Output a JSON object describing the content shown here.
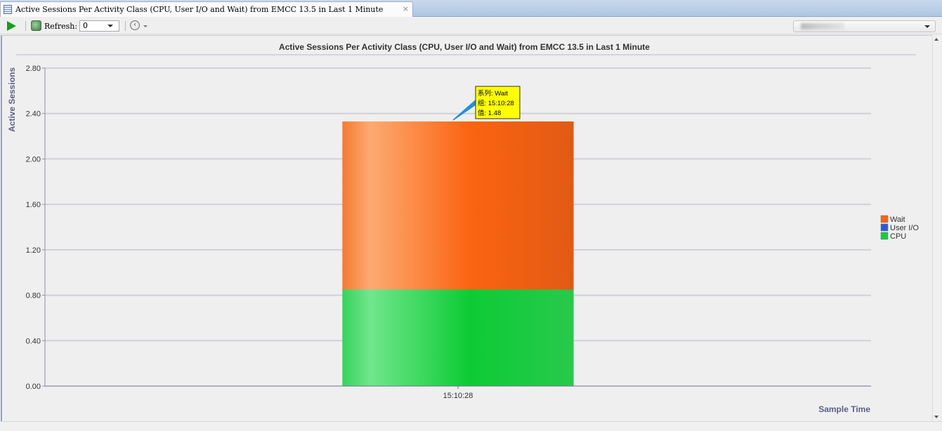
{
  "tab": {
    "title": "Active Sessions Per Activity Class (CPU, User I/O and Wait) from EMCC 13.5 in Last 1 Minute",
    "close_glyph": "×"
  },
  "toolbar": {
    "refresh_label": "Refresh:",
    "refresh_value": "0",
    "back_glyph": "‹"
  },
  "icons": {
    "run": "play-icon",
    "refresh": "refresh-icon",
    "back": "back-arrow-icon"
  },
  "chart_data": {
    "type": "bar",
    "stacked": true,
    "title": "Active Sessions Per Activity Class (CPU, User I/O and Wait) from EMCC 13.5 in Last 1 Minute",
    "xlabel": "Sample Time",
    "ylabel": "Active Sessions",
    "categories": [
      "15:10:28"
    ],
    "ylim": [
      0,
      2.8
    ],
    "yticks": [
      "0.00",
      "0.40",
      "0.80",
      "1.20",
      "1.60",
      "2.00",
      "2.40",
      "2.80"
    ],
    "series": [
      {
        "name": "CPU",
        "values": [
          0.85
        ],
        "color": "#16cc3a"
      },
      {
        "name": "User I/O",
        "values": [
          0
        ],
        "color": "#2a5bd6"
      },
      {
        "name": "Wait",
        "values": [
          1.48
        ],
        "color": "#f86412"
      }
    ],
    "legend_order": [
      "Wait",
      "User I/O",
      "CPU"
    ],
    "legend_position": "right",
    "grid": true,
    "tooltip": {
      "lines": [
        "系列: Wait",
        "组: 15:10:28",
        "值: 1.48"
      ],
      "color": "#ffff00"
    }
  }
}
